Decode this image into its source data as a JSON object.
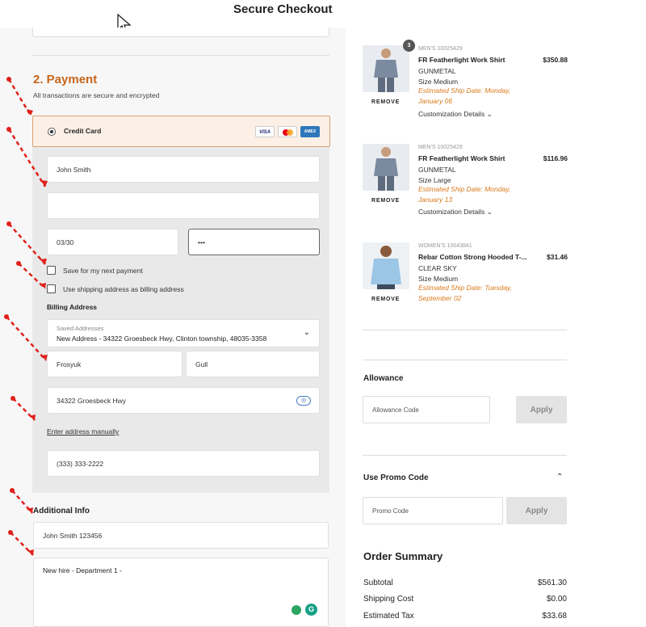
{
  "header": {
    "title": "Secure Checkout"
  },
  "payment": {
    "title": "2. Payment",
    "subtitle": "All transactions are secure and encrypted",
    "credit_card_label": "Credit Card",
    "card_logos": {
      "visa": "VISA",
      "amex": "AMEX"
    },
    "name_on_card": "John Smith",
    "card_number": "",
    "expiry": "03/30",
    "cvv": "•••",
    "save_payment_label": "Save for my next payment",
    "use_shipping_label": "Use shipping address as billing address",
    "billing_address_label": "Billing Address",
    "saved_addresses_label": "Saved Addresses",
    "saved_address_value": "New Address - 34322 Groesbeck Hwy, Clinton township, 48035-3358",
    "first_name": "Frosyuk",
    "last_name": "Gull",
    "street": "34322 Groesbeck Hwy",
    "enter_manually_label": "Enter address manually",
    "phone": "(333) 333-2222"
  },
  "additional_info": {
    "title": "Additional Info",
    "reference": "John Smith 123456",
    "notes": "New hire - Department 1 -"
  },
  "cart": {
    "remove_label": "REMOVE",
    "customization_label": "Customization Details",
    "items": [
      {
        "meta": "MEN'S 10025429",
        "name": "FR Featherlight Work Shirt",
        "price": "$350.88",
        "color": "GUNMETAL",
        "size": "Size Medium",
        "ship_line1": "Estimated Ship Date: Monday,",
        "ship_line2": "January 06",
        "qty": "3"
      },
      {
        "meta": "MEN'S 10025429",
        "name": "FR Featherlight Work Shirt",
        "price": "$116.96",
        "color": "GUNMETAL",
        "size": "Size Large",
        "ship_line1": "Estimated Ship Date: Monday,",
        "ship_line2": "January 13"
      },
      {
        "meta": "WOMEN'S 10043841",
        "name": "Rebar Cotton Strong Hooded T-...",
        "price": "$31.46",
        "color": "CLEAR SKY",
        "size": "Size Medium",
        "ship_line1": "Estimated Ship Date: Tuesday,",
        "ship_line2": "September 02"
      }
    ]
  },
  "allowance": {
    "title": "Allowance",
    "placeholder": "Allowance Code",
    "apply_label": "Apply"
  },
  "promo": {
    "title": "Use Promo Code",
    "placeholder": "Promo Code",
    "apply_label": "Apply"
  },
  "order_summary": {
    "title": "Order Summary",
    "rows": [
      {
        "label": "Subtotal",
        "value": "$561.30"
      },
      {
        "label": "Shipping Cost",
        "value": "$0.00"
      },
      {
        "label": "Estimated Tax",
        "value": "$33.68"
      }
    ]
  },
  "colors": {
    "accent": "#c8651b",
    "ship_text": "#d97a1c",
    "annotation_arrow": "#e0201b"
  }
}
